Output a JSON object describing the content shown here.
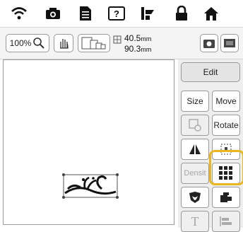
{
  "toolbar": {
    "zoom_label": "100%",
    "width_value": "40.5",
    "width_unit": "mm",
    "height_value": "90.3",
    "height_unit": "mm"
  },
  "panel": {
    "edit_label": "Edit",
    "size_label": "Size",
    "move_label": "Move",
    "rotate_label": "Rotate",
    "density_label": "Densit",
    "text_label": "T"
  },
  "highlight_color": "#e9b71f"
}
